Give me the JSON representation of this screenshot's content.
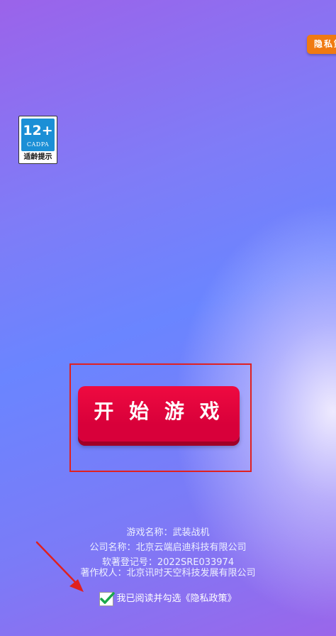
{
  "top_bar": {
    "privacy_label": "隐私策"
  },
  "age_rating": {
    "age": "12+",
    "org": "CADPA",
    "caption": "适龄提示"
  },
  "start_button": {
    "label": "开 始 游 戏"
  },
  "info": {
    "game_name": "游戏名称：武装战机",
    "company_name": "公司名称：北京云端启迪科技有限公司",
    "software_reg": "软著登记号：2022SRE033974",
    "copyright_owner": "著作权人：北京讯时天空科技发展有限公司"
  },
  "agreement": {
    "text": "我已阅读并勾选《隐私政策》",
    "checked": true
  },
  "colors": {
    "start_button": "#e8063e",
    "privacy_button": "#f07a12",
    "annotation": "#e02020",
    "checkmark": "#1aa84a"
  }
}
